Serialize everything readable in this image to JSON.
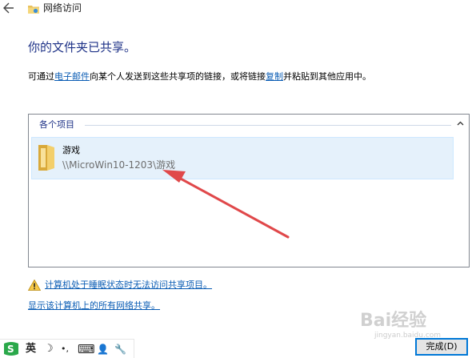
{
  "window": {
    "title": "网络访问"
  },
  "main": {
    "heading": "你的文件夹已共享。",
    "description": {
      "part1": "可通过",
      "email_link": "电子邮件",
      "part2": "向某个人发送到这些共享项的链接，或将链接",
      "copy_link": "复制",
      "part3": "并粘贴到其他应用中。"
    }
  },
  "panel": {
    "group_label": "各个项目",
    "items": [
      {
        "name": "游戏",
        "path": "\\\\MicroWin10-1203\\游戏"
      }
    ]
  },
  "links": {
    "sleep_warning": "计算机处于睡眠状态时无法访问共享项目。",
    "show_all": "显示该计算机上的所有网络共享。"
  },
  "ime_toolbar": {
    "language": "英",
    "moon": "☽",
    "punct": "•,",
    "keyboard": "⌨",
    "user": "👤",
    "tools": "🔧"
  },
  "watermark": {
    "text": "Bai经验",
    "sub": "jingyan.baidu.com"
  },
  "footer": {
    "finish_label": "完成(D)"
  },
  "colors": {
    "heading": "#1e3287",
    "link": "#0a5cb4",
    "selection": "#e5f1fb",
    "annotation_arrow": "#e0484a",
    "button_border": "#0078d7"
  }
}
